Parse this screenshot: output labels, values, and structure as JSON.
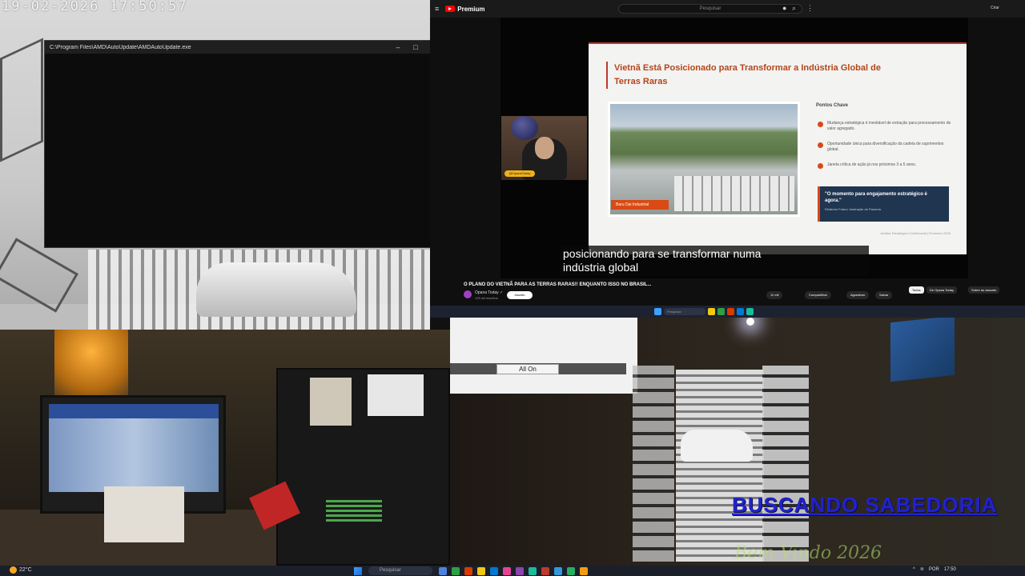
{
  "camera_top_left": {
    "timestamp": "19-02-2026 17:50:57"
  },
  "console_window": {
    "title": "C:\\Program Files\\AMD\\AutoUpdate\\AMDAutoUpdate.exe",
    "minimize": "–",
    "maximize": "□",
    "close": "✕"
  },
  "browser": {
    "brand": "Premium",
    "search_placeholder": "Pesquisar",
    "topbar_icons": [
      "mic-icon",
      "search-icon",
      "more-icon"
    ],
    "user_chip": "Criar",
    "slide": {
      "title": "Vietnã Está Posicionado para Transformar a Indústria Global de Terras Raras",
      "photo_caption": "Baru Dai Industrial",
      "key_points_title": "Pontos Chave",
      "key_points": [
        "Mudança estratégica é inevitável de extração para processamento de valor agregado.",
        "Oportunidade única para diversificação da cadeia de suprimentos global.",
        "Janela crítica de ação já nos próximos 3 a 5 anos."
      ],
      "quote": "\"O momento para engajamento estratégico é agora.\"",
      "quote_source": "Relatório Futuro: Ilustração de Parceria",
      "footer": "Análise Estratégica Confidencial | Fevereiro 2026"
    },
    "webcam_tag": "@OpanaToday",
    "subtitle_line1": "posicionando para se transformar numa",
    "subtitle_line2": "indústria global",
    "video_title": "O PLANO DO VIETNÃ PARA AS TERRAS RARAS!! ENQUANTO ISSO NO BRASIL...",
    "channel_name": "Opana Today ✓",
    "channel_subs": "125 mil inscritos",
    "join_label": "Inscrito",
    "actions": {
      "likes": "11 mil",
      "share": "Compartilhar",
      "save": "Agradecer",
      "clip": "Salvar"
    },
    "chips": [
      "Todos",
      "De Opana Today",
      "Sobre ao assunto"
    ],
    "taskbar_search": "Pesquisar"
  },
  "camera_bottom_right": {
    "button_all_on": "All On",
    "overlay_title": "BUSCANDO SABEDORIA",
    "overlay_subtitle": "Bem Vindo 2026"
  },
  "taskbar": {
    "weather": "22°C",
    "search_placeholder": "Pesquisar",
    "app_colors": [
      "#4c82e0",
      "#2ea043",
      "#d83b01",
      "#f2c811",
      "#0078d4",
      "#e84393",
      "#8e44ad",
      "#1abc9c",
      "#c0392b",
      "#3498db",
      "#27ae60",
      "#f39c12"
    ],
    "lang": "POR",
    "time": "17:50"
  },
  "colors": {
    "slide_accent": "#c0392b",
    "quote_bg": "#1f3550",
    "overlay_blue": "#2222cc",
    "overlay_green": "#b6e06a"
  }
}
